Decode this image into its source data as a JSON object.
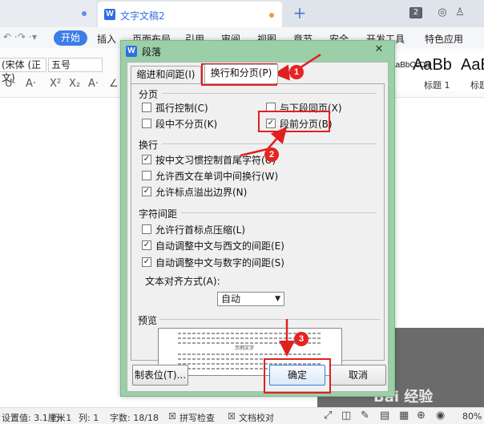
{
  "window": {
    "tabs": [
      {
        "label": "文字文稿2",
        "icon": "wps-writer-icon"
      }
    ],
    "tab_count": "2",
    "new_tab_label": "+"
  },
  "menu": {
    "start_label": "开始",
    "items": [
      "插入",
      "页面布局",
      "引用",
      "审阅",
      "视图",
      "章节",
      "安全",
      "开发工具",
      "特色应用"
    ]
  },
  "toolbar": {
    "font_name": "(宋体 (正文)",
    "font_size": "五号",
    "style_samples": [
      {
        "sample": "AaBbCcDd",
        "caption": ""
      },
      {
        "sample": "AaBb",
        "caption": "标题 1"
      },
      {
        "sample": "AaBl",
        "caption": "标题"
      }
    ]
  },
  "dialog": {
    "title": "段落",
    "tabs": [
      "缩进和间距(I)",
      "换行和分页(P)"
    ],
    "active_tab": 1,
    "sections": {
      "pagination": {
        "label": "分页",
        "options": [
          {
            "label": "孤行控制(C)",
            "checked": false
          },
          {
            "label": "与下段同页(X)",
            "checked": false
          },
          {
            "label": "段中不分页(K)",
            "checked": false
          },
          {
            "label": "段前分页(B)",
            "checked": true
          }
        ]
      },
      "line_break": {
        "label": "换行",
        "options": [
          {
            "label": "按中文习惯控制首尾字符(U)",
            "checked": true
          },
          {
            "label": "允许西文在单词中间换行(W)",
            "checked": false
          },
          {
            "label": "允许标点溢出边界(N)",
            "checked": true
          }
        ]
      },
      "char_spacing": {
        "label": "字符间距",
        "options": [
          {
            "label": "允许行首标点压缩(L)",
            "checked": false
          },
          {
            "label": "自动调整中文与西文的间距(E)",
            "checked": true
          },
          {
            "label": "自动调整中文与数字的间距(S)",
            "checked": true
          }
        ]
      },
      "alignment": {
        "label": "文本对齐方式(A):",
        "value": "自动"
      },
      "preview": {
        "label": "预览",
        "sample_text": "示例文字"
      }
    },
    "buttons": {
      "tabs_button": "制表位(T)...",
      "ok": "确定",
      "cancel": "取消"
    }
  },
  "annotations": [
    "1",
    "2",
    "3"
  ],
  "status": {
    "position": "设置值: 3.1厘米",
    "row": "行: 1",
    "col": "列: 1",
    "word_count": "字数: 18/18",
    "spell_check": "拼写检查",
    "doc_check": "文档校对",
    "zoom": "80%",
    "watermark": "Bai 经验"
  },
  "colors": {
    "accent": "#3c7de6",
    "dialog_frame": "#9bcfa8",
    "annotation_red": "#e02020"
  }
}
